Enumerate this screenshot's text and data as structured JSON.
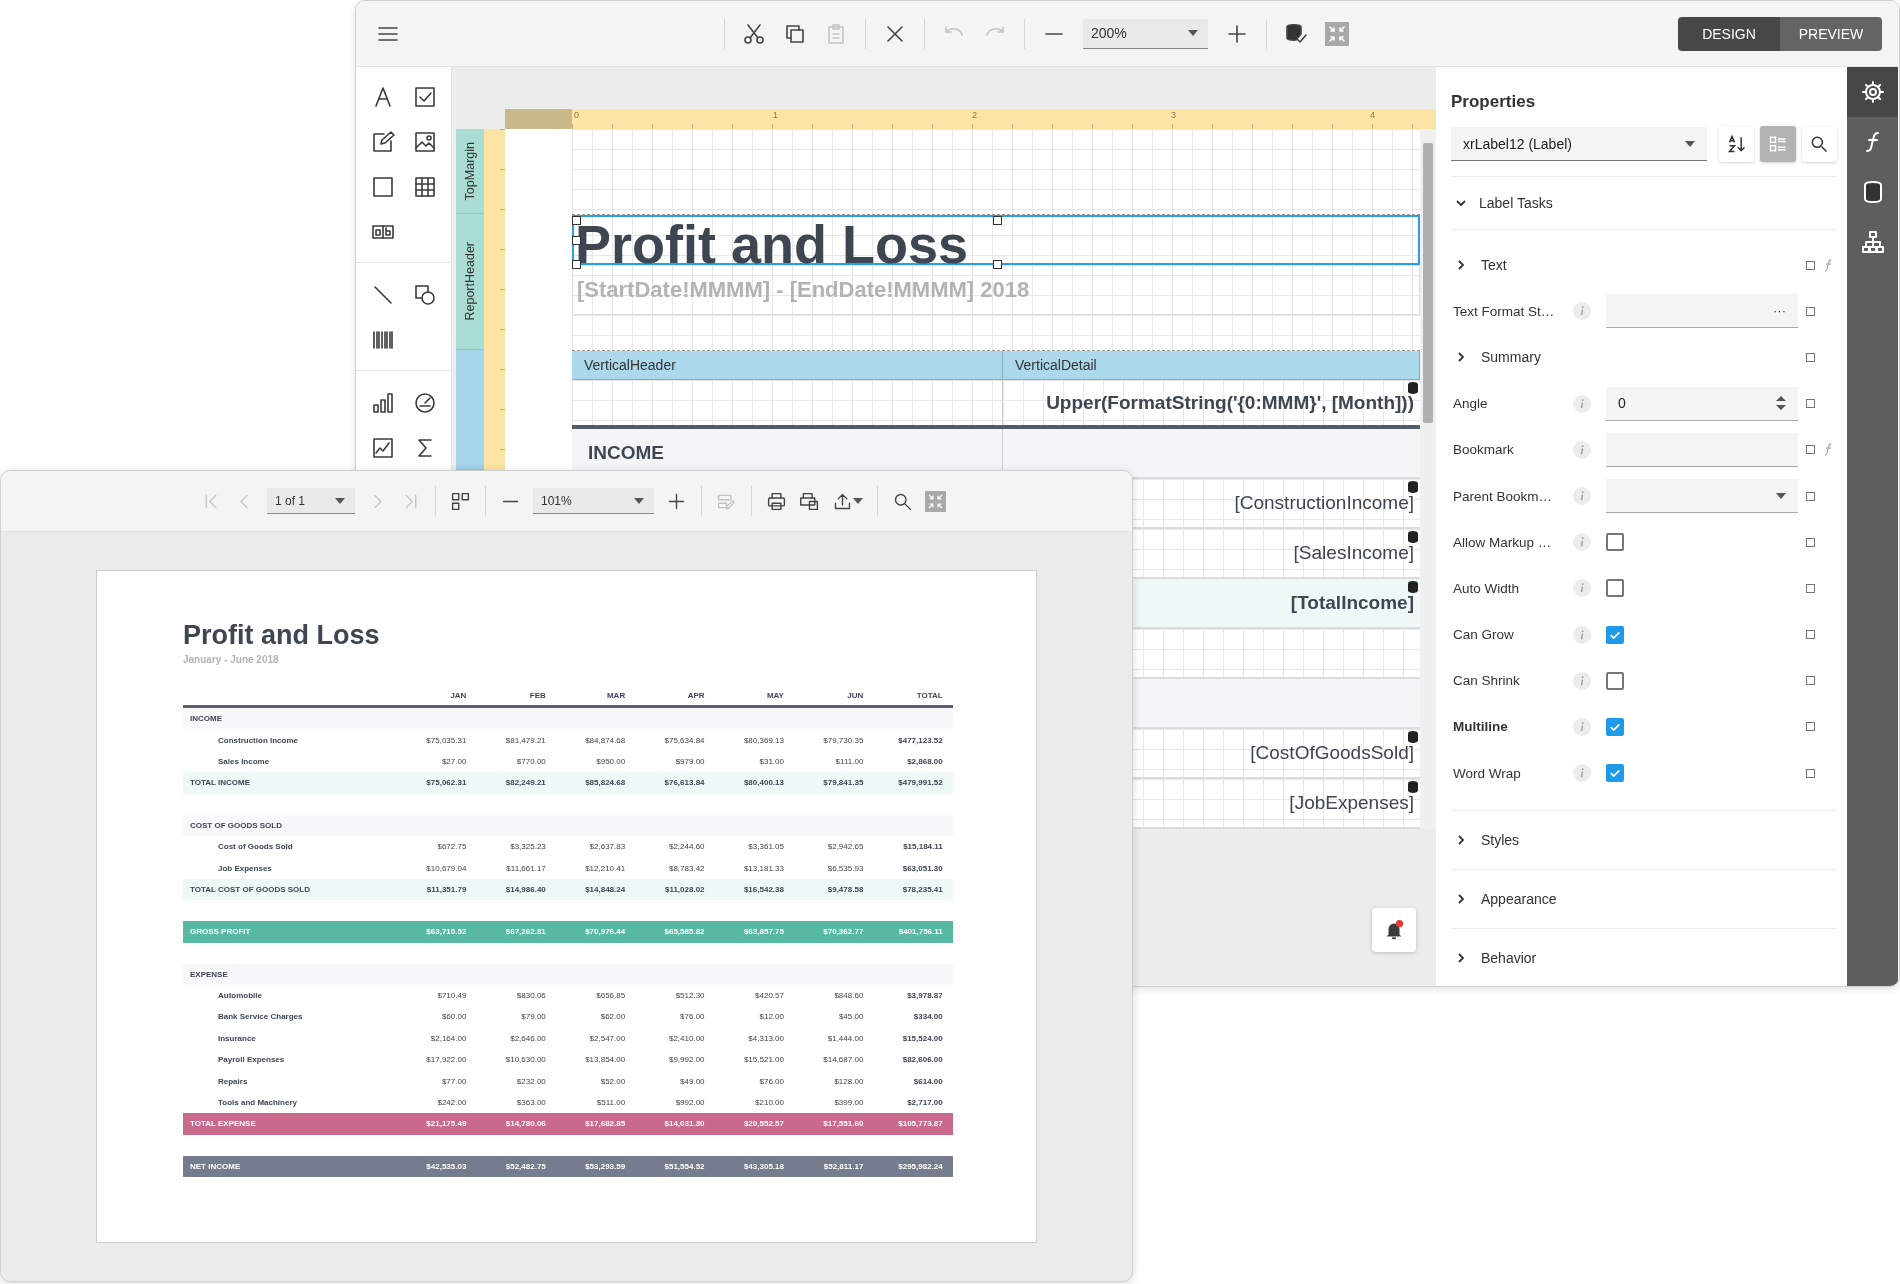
{
  "designer": {
    "toolbar_groups": [
      [
        {
          "kind": "cut",
          "disabled": false
        },
        {
          "kind": "copy",
          "disabled": false
        },
        {
          "kind": "paste",
          "disabled": true
        }
      ],
      [
        {
          "kind": "delete",
          "disabled": false
        }
      ],
      [
        {
          "kind": "undo",
          "disabled": true
        },
        {
          "kind": "redo",
          "disabled": true
        }
      ],
      [
        {
          "kind": "zoom-out",
          "disabled": false
        },
        {
          "kind": "zoom",
          "value": "200%"
        },
        {
          "kind": "zoom-in",
          "disabled": false
        }
      ],
      [
        {
          "kind": "validate",
          "disabled": false
        },
        {
          "kind": "fullscreen"
        }
      ]
    ],
    "modes": [
      {
        "label": "DESIGN",
        "selected": true
      },
      {
        "label": "PREVIEW",
        "selected": false
      }
    ],
    "toolbox_groups": [
      [
        {
          "kind": "label"
        },
        {
          "kind": "checkbox"
        },
        {
          "kind": "rich-text"
        },
        {
          "kind": "picture-box"
        },
        {
          "kind": "panel"
        },
        {
          "kind": "table"
        },
        {
          "kind": "character-comb"
        }
      ],
      [
        {
          "kind": "line"
        },
        {
          "kind": "shape"
        },
        {
          "kind": "barcode"
        }
      ],
      [
        {
          "kind": "chart"
        },
        {
          "kind": "gauge"
        },
        {
          "kind": "sparkline"
        },
        {
          "kind": "summary"
        }
      ]
    ],
    "canvas": {
      "ruler_labels": [
        "0",
        "1",
        "2",
        "3",
        "4"
      ],
      "bands": [
        {
          "kind": "margin",
          "name": "TopMargin"
        },
        {
          "kind": "header",
          "name": "ReportHeader"
        },
        {
          "kind": "vertical"
        }
      ],
      "title": {
        "text": "Profit and Loss",
        "selected": true
      },
      "subtitle": "[StartDate!MMMM] - [EndDate!MMMM] 2018",
      "band_headers": [
        "VerticalHeader",
        "VerticalDetail"
      ],
      "rows": [
        {
          "kind": "month",
          "field": "Upper(FormatString('{0:MMM}', [Month]))"
        },
        {
          "kind": "section",
          "label": "INCOME"
        },
        {
          "kind": "item",
          "field": "[ConstructionIncome]"
        },
        {
          "kind": "item",
          "field": "[SalesIncome]"
        },
        {
          "kind": "total",
          "field": "[TotalIncome]"
        },
        {
          "kind": "blank"
        },
        {
          "kind": "section"
        },
        {
          "kind": "item",
          "field": "[CostOfGoodsSold]"
        },
        {
          "kind": "item",
          "field": "[JobExpenses]"
        }
      ],
      "notifications": {
        "unread": true
      }
    },
    "properties": {
      "title": "Properties",
      "control": "xrLabel12 (Label)",
      "tools": [
        {
          "kind": "sort",
          "selected": false
        },
        {
          "kind": "categories",
          "selected": true
        },
        {
          "kind": "search",
          "selected": false
        }
      ],
      "task_group": {
        "label": "Label Tasks",
        "expanded": true
      },
      "items": [
        {
          "kind": "group",
          "label": "Text",
          "expanded": false,
          "expression": true
        },
        {
          "kind": "dialog",
          "label": "Text Format St…",
          "button": "···",
          "expression": false,
          "modified": false
        },
        {
          "kind": "group",
          "label": "Summary",
          "expanded": false,
          "expression": false
        },
        {
          "kind": "number",
          "label": "Angle",
          "value": "0",
          "expression": false,
          "modified": false
        },
        {
          "kind": "text",
          "label": "Bookmark",
          "expression": true,
          "modified": false
        },
        {
          "kind": "select",
          "label": "Parent Bookm…",
          "expression": false,
          "modified": false
        },
        {
          "kind": "checkbox",
          "label": "Allow Markup …",
          "checked": false,
          "expression": false,
          "modified": false
        },
        {
          "kind": "checkbox",
          "label": "Auto Width",
          "checked": false,
          "expression": false,
          "modified": false
        },
        {
          "kind": "checkbox",
          "label": "Can Grow",
          "checked": true,
          "expression": false,
          "modified": false
        },
        {
          "kind": "checkbox",
          "label": "Can Shrink",
          "checked": false,
          "expression": false,
          "modified": false
        },
        {
          "kind": "checkbox",
          "label": "Multiline",
          "checked": true,
          "expression": false,
          "modified": true
        },
        {
          "kind": "checkbox",
          "label": "Word Wrap",
          "checked": true,
          "expression": false,
          "modified": false
        }
      ],
      "sections": [
        {
          "label": "Styles",
          "expanded": false
        },
        {
          "label": "Appearance",
          "expanded": false
        },
        {
          "label": "Behavior",
          "expanded": false
        }
      ]
    },
    "side_tabs": [
      {
        "kind": "properties",
        "selected": true
      },
      {
        "kind": "expressions",
        "selected": false
      },
      {
        "kind": "data",
        "selected": false
      },
      {
        "kind": "structure",
        "selected": false
      }
    ]
  },
  "preview": {
    "toolbar_groups": [
      [
        {
          "kind": "first",
          "disabled": true
        },
        {
          "kind": "prev",
          "disabled": true
        },
        {
          "kind": "page",
          "value": "1 of 1"
        },
        {
          "kind": "next",
          "disabled": true
        },
        {
          "kind": "last",
          "disabled": true
        }
      ],
      [
        {
          "kind": "multipage",
          "disabled": false
        }
      ],
      [
        {
          "kind": "zoom-out",
          "disabled": false
        },
        {
          "kind": "zoom",
          "value": "101%"
        },
        {
          "kind": "zoom-in",
          "disabled": false
        }
      ],
      [
        {
          "kind": "edit-fields",
          "disabled": true
        }
      ],
      [
        {
          "kind": "print",
          "disabled": false
        },
        {
          "kind": "print-page",
          "disabled": false
        },
        {
          "kind": "export",
          "disabled": false
        }
      ],
      [
        {
          "kind": "search",
          "disabled": false
        },
        {
          "kind": "fullscreen"
        }
      ]
    ],
    "report": {
      "title": "Profit and Loss",
      "subtitle": "January - June 2018",
      "columns": [
        "JAN",
        "FEB",
        "MAR",
        "APR",
        "MAY",
        "JUN",
        "TOTAL"
      ],
      "rows": [
        {
          "kind": "section",
          "label": "INCOME"
        },
        {
          "kind": "item",
          "label": "Construction Income",
          "values": [
            "$75,035.31",
            "$81,479.21",
            "$84,874.68",
            "$75,634.84",
            "$80,369.13",
            "$79,730.35",
            "$477,123.52"
          ]
        },
        {
          "kind": "item",
          "label": "Sales Income",
          "values": [
            "$27.00",
            "$770.00",
            "$950.00",
            "$979.00",
            "$31.00",
            "$111.00",
            "$2,868.00"
          ]
        },
        {
          "kind": "total",
          "label": "TOTAL INCOME",
          "values": [
            "$75,062.31",
            "$82,249.21",
            "$85,824.68",
            "$76,613.84",
            "$80,400.13",
            "$79,841.35",
            "$479,991.52"
          ]
        },
        {
          "kind": "section",
          "label": "COST OF GOODS SOLD"
        },
        {
          "kind": "item",
          "label": "Cost of Goods Sold",
          "values": [
            "$672.75",
            "$3,325.23",
            "$2,637.83",
            "$2,244.60",
            "$3,361.05",
            "$2,942.65",
            "$15,184.11"
          ]
        },
        {
          "kind": "item",
          "label": "Job Expenses",
          "values": [
            "$10,679.04",
            "$11,661.17",
            "$12,210.41",
            "$8,783.42",
            "$13,181.33",
            "$6,535.93",
            "$63,051.30"
          ]
        },
        {
          "kind": "total",
          "label": "TOTAL COST OF GOODS SOLD",
          "values": [
            "$11,351.79",
            "$14,986.40",
            "$14,848.24",
            "$11,028.02",
            "$16,542.38",
            "$9,478.58",
            "$78,235.41"
          ]
        },
        {
          "kind": "gross",
          "label": "GROSS PROFIT",
          "values": [
            "$63,710.52",
            "$67,262.81",
            "$70,976.44",
            "$65,585.82",
            "$63,857.75",
            "$70,362.77",
            "$401,756.11"
          ]
        },
        {
          "kind": "section",
          "label": "EXPENSE"
        },
        {
          "kind": "item",
          "label": "Automobile",
          "values": [
            "$710.49",
            "$830.06",
            "$656.85",
            "$512.30",
            "$420.57",
            "$848.60",
            "$3,978.87"
          ]
        },
        {
          "kind": "item",
          "label": "Bank Service Charges",
          "values": [
            "$60.00",
            "$79.00",
            "$62.00",
            "$76.00",
            "$12.00",
            "$45.00",
            "$334.00"
          ]
        },
        {
          "kind": "item",
          "label": "Insurance",
          "values": [
            "$2,164.00",
            "$2,646.00",
            "$2,547.00",
            "$2,410.00",
            "$4,313.00",
            "$1,444.00",
            "$15,524.00"
          ]
        },
        {
          "kind": "item",
          "label": "Payroll Expenses",
          "values": [
            "$17,922.00",
            "$10,630.00",
            "$13,854.00",
            "$9,992.00",
            "$15,521.00",
            "$14,687.00",
            "$82,606.00"
          ]
        },
        {
          "kind": "item",
          "label": "Repairs",
          "values": [
            "$77.00",
            "$232.00",
            "$52.00",
            "$49.00",
            "$76.00",
            "$128.00",
            "$614.00"
          ]
        },
        {
          "kind": "item",
          "label": "Tools and Machinery",
          "values": [
            "$242.00",
            "$363.00",
            "$511.00",
            "$992.00",
            "$210.00",
            "$399.00",
            "$2,717.00"
          ]
        },
        {
          "kind": "expense_total",
          "label": "TOTAL EXPENSE",
          "values": [
            "$21,175.49",
            "$14,780.06",
            "$17,682.85",
            "$14,031.30",
            "$20,552.57",
            "$17,551.60",
            "$105,773.87"
          ]
        },
        {
          "kind": "net",
          "label": "NET INCOME",
          "values": [
            "$42,535.03",
            "$52,482.75",
            "$53,293.59",
            "$51,554.52",
            "$43,305.18",
            "$52,811.17",
            "$295,982.24"
          ]
        }
      ]
    }
  }
}
